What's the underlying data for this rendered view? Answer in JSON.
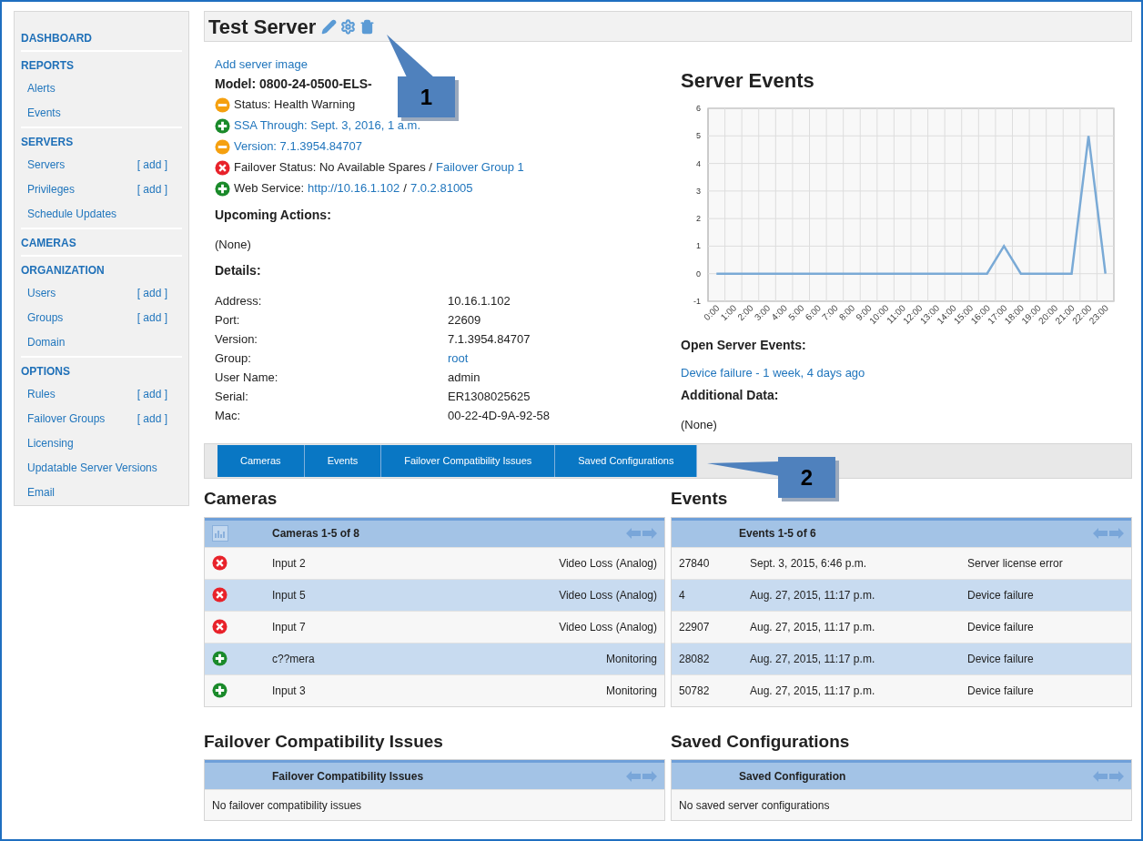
{
  "sidebar": {
    "sections": [
      {
        "title": "DASHBOARD"
      },
      {
        "title": "REPORTS",
        "items": [
          {
            "label": "Alerts"
          },
          {
            "label": "Events"
          }
        ]
      },
      {
        "title": "SERVERS",
        "items": [
          {
            "label": "Servers",
            "add": "[ add ]"
          },
          {
            "label": "Privileges",
            "add": "[ add ]"
          },
          {
            "label": "Schedule Updates"
          }
        ]
      },
      {
        "title": "CAMERAS"
      },
      {
        "title": "ORGANIZATION",
        "items": [
          {
            "label": "Users",
            "add": "[ add ]"
          },
          {
            "label": "Groups",
            "add": "[ add ]"
          },
          {
            "label": "Domain"
          }
        ]
      },
      {
        "title": "OPTIONS",
        "items": [
          {
            "label": "Rules",
            "add": "[ add ]"
          },
          {
            "label": "Failover Groups",
            "add": "[ add ]"
          },
          {
            "label": "Licensing"
          },
          {
            "label": "Updatable Server Versions"
          },
          {
            "label": "Email"
          }
        ]
      }
    ]
  },
  "server": {
    "title": "Test Server",
    "add_image": "Add server image",
    "model": "Model: 0800-24-0500-ELS-",
    "statuses": [
      {
        "kind": "warning",
        "parts": [
          {
            "text": "Status: Health Warning",
            "link": false
          }
        ]
      },
      {
        "kind": "ok",
        "parts": [
          {
            "text": "SSA Through: Sept. 3, 2016, 1 a.m.",
            "link": true
          }
        ]
      },
      {
        "kind": "warning",
        "parts": [
          {
            "text": "Version: 7.1.3954.84707",
            "link": true
          }
        ]
      },
      {
        "kind": "error",
        "parts": [
          {
            "text": "Failover Status: No Available Spares /",
            "link": false
          },
          {
            "text": "Failover Group 1",
            "link": true
          }
        ]
      },
      {
        "kind": "ok",
        "parts": [
          {
            "text": "Web Service:",
            "link": false
          },
          {
            "text": "http://10.16.1.102",
            "link": true
          },
          {
            "text": "/",
            "link": false
          },
          {
            "text": "7.0.2.81005",
            "link": true
          }
        ]
      }
    ],
    "upcoming_heading": "Upcoming Actions:",
    "upcoming_value": "(None)",
    "details_heading": "Details:",
    "details": [
      {
        "label": "Address:",
        "value": "10.16.1.102",
        "link": false
      },
      {
        "label": "Port:",
        "value": "22609",
        "link": false
      },
      {
        "label": "Version:",
        "value": "7.1.3954.84707",
        "link": false
      },
      {
        "label": "Group:",
        "value": "root",
        "link": true
      },
      {
        "label": "User Name:",
        "value": "admin",
        "link": false
      },
      {
        "label": "Serial:",
        "value": "ER1308025625",
        "link": false
      },
      {
        "label": "Mac:",
        "value": "00-22-4D-9A-92-58",
        "link": false
      }
    ]
  },
  "server_events": {
    "title": "Server Events",
    "chart_data": {
      "type": "line",
      "categories": [
        "0:00",
        "1:00",
        "2:00",
        "3:00",
        "4:00",
        "5:00",
        "6:00",
        "7:00",
        "8:00",
        "9:00",
        "10:00",
        "11:00",
        "12:00",
        "13:00",
        "14:00",
        "15:00",
        "16:00",
        "17:00",
        "18:00",
        "19:00",
        "20:00",
        "21:00",
        "22:00",
        "23:00"
      ],
      "series": [
        {
          "color": "#7aaad6",
          "values": [
            0,
            0,
            0,
            0,
            0,
            0,
            0,
            0,
            0,
            0,
            0,
            0,
            0,
            0,
            0,
            0,
            0,
            1,
            0,
            0,
            0,
            0,
            5,
            0
          ]
        }
      ],
      "ylim": [
        -1,
        6
      ],
      "grid": true,
      "yticks": [
        {
          "value": -1,
          "label": "-1"
        },
        {
          "value": 0,
          "label": "0"
        },
        {
          "value": 1,
          "label": "1"
        },
        {
          "value": 2,
          "label": "2"
        },
        {
          "value": 3,
          "label": "3"
        },
        {
          "value": 4,
          "label": "4"
        },
        {
          "value": 5,
          "label": "5"
        },
        {
          "value": 6,
          "label": "6"
        }
      ]
    },
    "open_heading": "Open Server Events:",
    "open_link": "Device failure - 1 week, 4 days ago",
    "additional_heading": "Additional Data:",
    "additional_value": "(None)"
  },
  "tabs": [
    {
      "label": "Cameras",
      "selected": false
    },
    {
      "label": "Events",
      "selected": false
    },
    {
      "label": "Failover Compatibility Issues",
      "selected": false
    },
    {
      "label": "Saved Configurations",
      "selected": false
    }
  ],
  "cameras": {
    "title": "Cameras",
    "header": "Cameras 1-5 of 8",
    "rows": [
      {
        "kind": "error",
        "name": "Input 2",
        "state": "Video Loss (Analog)"
      },
      {
        "kind": "error",
        "name": "Input 5",
        "state": "Video Loss (Analog)"
      },
      {
        "kind": "error",
        "name": "Input 7",
        "state": "Video Loss (Analog)"
      },
      {
        "kind": "ok",
        "name": "c??mera",
        "state": "Monitoring"
      },
      {
        "kind": "ok",
        "name": "Input 3",
        "state": "Monitoring"
      }
    ]
  },
  "events": {
    "title": "Events",
    "header": "Events 1-5 of 6",
    "rows": [
      {
        "id": "27840",
        "date": "Sept. 3, 2015, 6:46 p.m.",
        "description": "Server license error"
      },
      {
        "id": "4",
        "date": "Aug. 27, 2015, 11:17 p.m.",
        "description": "Device failure"
      },
      {
        "id": "22907",
        "date": "Aug. 27, 2015, 11:17 p.m.",
        "description": "Device failure"
      },
      {
        "id": "28082",
        "date": "Aug. 27, 2015, 11:17 p.m.",
        "description": "Device failure"
      },
      {
        "id": "50782",
        "date": "Aug. 27, 2015, 11:17 p.m.",
        "description": "Device failure"
      }
    ]
  },
  "failover": {
    "title": "Failover Compatibility Issues",
    "header": "Failover Compatibility Issues",
    "message": "No failover compatibility issues"
  },
  "saved": {
    "title": "Saved Configurations",
    "header": "Saved Configuration",
    "message": "No saved server configurations"
  },
  "callouts": [
    {
      "label": "1"
    },
    {
      "label": "2"
    }
  ]
}
